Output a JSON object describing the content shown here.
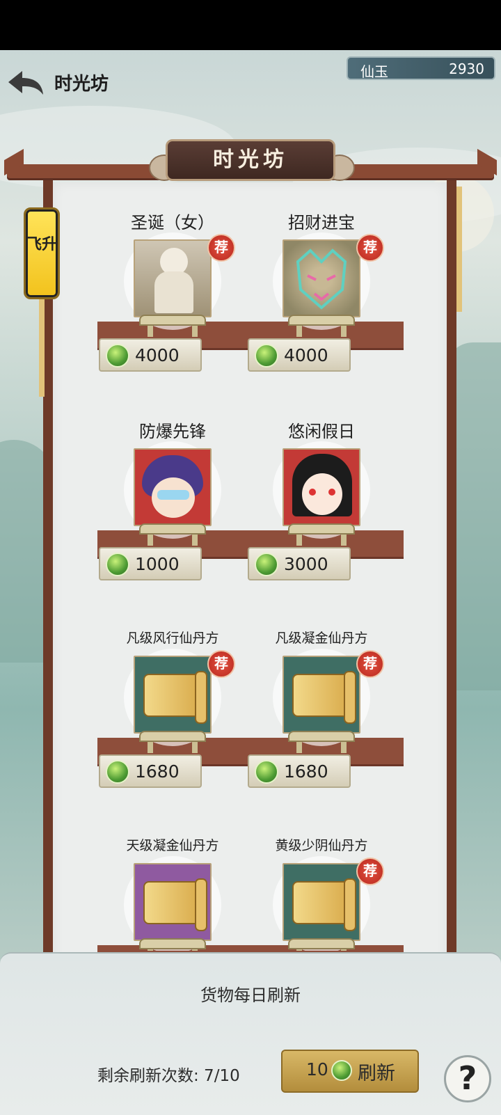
{
  "header": {
    "title": "时光坊",
    "back_icon": "back-arrow-icon"
  },
  "currency": {
    "label": "仙玉",
    "value": "2930"
  },
  "plaque": {
    "title": "时光坊"
  },
  "side_tab": {
    "label": "飞升"
  },
  "badge_text": "荐",
  "items": [
    {
      "name": "圣诞（女）",
      "price": "4000",
      "recommended": true
    },
    {
      "name": "招财进宝",
      "price": "4000",
      "recommended": true
    },
    {
      "name": "防爆先锋",
      "price": "1000",
      "recommended": false
    },
    {
      "name": "悠闲假日",
      "price": "3000",
      "recommended": false
    },
    {
      "name": "凡级风行仙丹方",
      "price": "1680",
      "recommended": true
    },
    {
      "name": "凡级凝金仙丹方",
      "price": "1680",
      "recommended": true
    },
    {
      "name": "天级凝金仙丹方",
      "price": "",
      "recommended": false
    },
    {
      "name": "黄级少阴仙丹方",
      "price": "",
      "recommended": true
    }
  ],
  "footer": {
    "notice": "货物每日刷新",
    "remaining": "剩余刷新次数: 7/10",
    "refresh_cost": "10",
    "refresh_label": "刷新",
    "help_label": "?"
  }
}
